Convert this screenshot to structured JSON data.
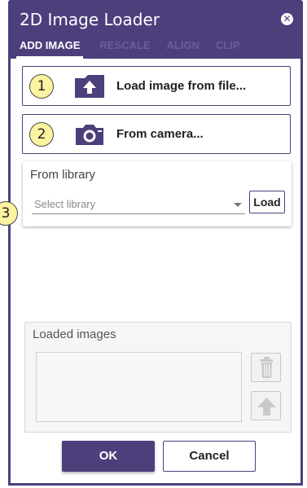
{
  "window": {
    "title": "2D Image Loader"
  },
  "tabs": [
    {
      "label": "ADD IMAGE",
      "active": true
    },
    {
      "label": "RESCALE",
      "active": false
    },
    {
      "label": "ALIGN",
      "active": false
    },
    {
      "label": "CLIP",
      "active": false
    }
  ],
  "actions": {
    "load_file": {
      "label": "Load image from file...",
      "icon": "upload-icon",
      "badge": "1"
    },
    "camera": {
      "label": "From camera...",
      "icon": "camera-icon",
      "badge": "2"
    }
  },
  "library": {
    "title": "From library",
    "placeholder": "Select library",
    "load_label": "Load",
    "badge": "3"
  },
  "loaded_images": {
    "title": "Loaded images",
    "items": []
  },
  "footer": {
    "ok_label": "OK",
    "cancel_label": "Cancel"
  },
  "colors": {
    "primary": "#4d3f7c",
    "badge": "#fdf3a0"
  }
}
